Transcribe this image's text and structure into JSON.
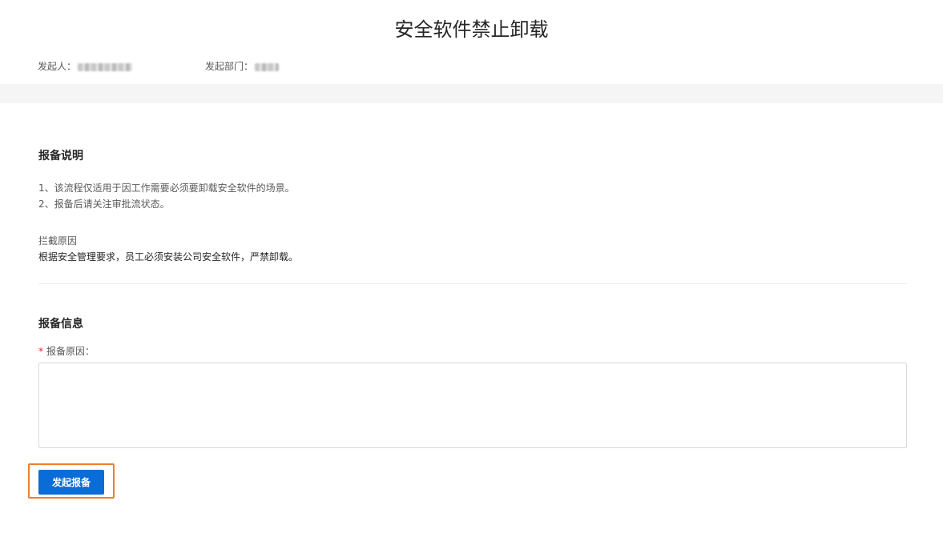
{
  "page": {
    "title": "安全软件禁止卸载"
  },
  "meta": {
    "initiator_label": "发起人：",
    "department_label": "发起部门："
  },
  "description_section": {
    "title": "报备说明",
    "lines": [
      "1、该流程仅适用于因工作需要必须要卸载安全软件的场景。",
      "2、报备后请关注审批流状态。"
    ],
    "block_reason_label": "拦截原因",
    "block_reason_text": "根据安全管理要求，员工必须安装公司安全软件，严禁卸载。"
  },
  "report_section": {
    "title": "报备信息",
    "required_mark": "*",
    "reason_label": "报备原因：",
    "reason_value": ""
  },
  "actions": {
    "submit_label": "发起报备"
  },
  "colors": {
    "primary_button": "#0a6cd6",
    "highlight_border": "#f07f2c",
    "required": "#f5222d"
  }
}
